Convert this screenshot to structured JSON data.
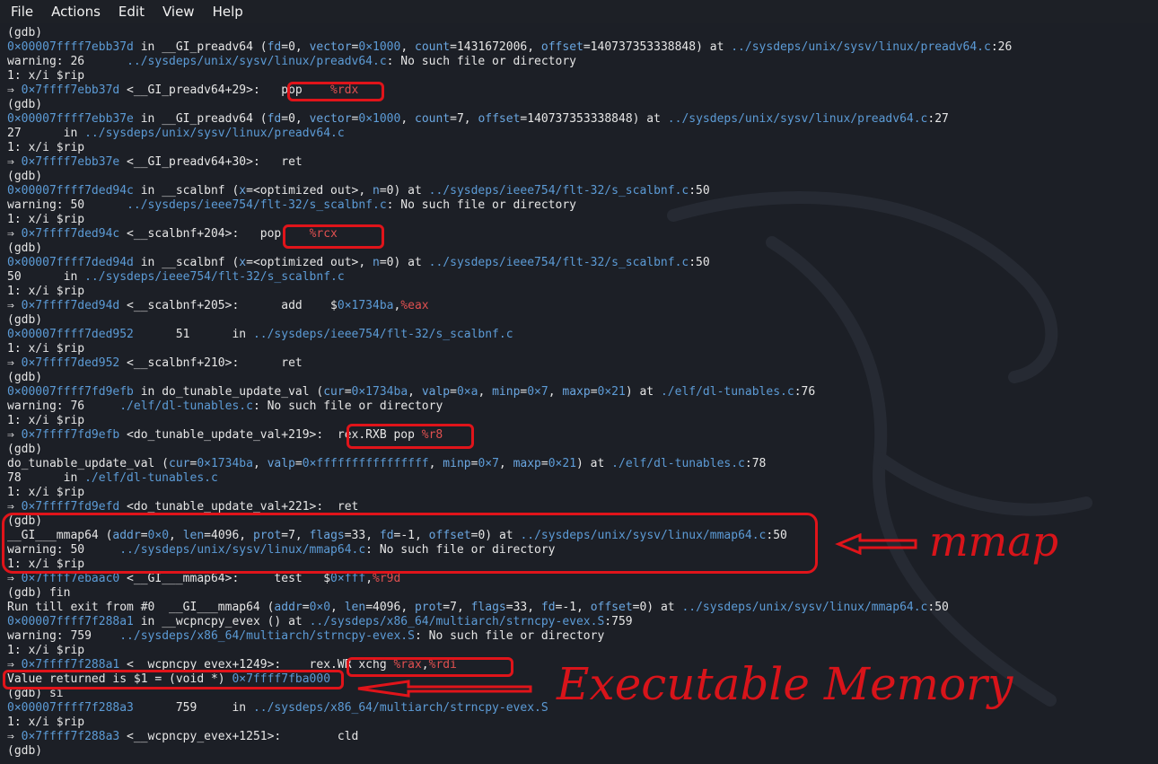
{
  "menubar": {
    "file": "File",
    "actions": "Actions",
    "edit": "Edit",
    "view": "View",
    "help": "Help"
  },
  "terminal": {
    "lines": [
      "(gdb)",
      "0×00007ffff7ebb37d in __GI_preadv64 (fd=0, vector=0×1000, count=1431672006, offset=140737353338848) at ../sysdeps/unix/sysv/linux/preadv64.c:26",
      "warning: 26      ../sysdeps/unix/sysv/linux/preadv64.c: No such file or directory",
      "1: x/i $rip",
      "⇒ 0×7ffff7ebb37d <__GI_preadv64+29>:   pop    %rdx",
      "(gdb)",
      "0×00007ffff7ebb37e in __GI_preadv64 (fd=0, vector=0×1000, count=7, offset=140737353338848) at ../sysdeps/unix/sysv/linux/preadv64.c:27",
      "27      in ../sysdeps/unix/sysv/linux/preadv64.c",
      "1: x/i $rip",
      "⇒ 0×7ffff7ebb37e <__GI_preadv64+30>:   ret",
      "(gdb)",
      "0×00007ffff7ded94c in __scalbnf (x=<optimized out>, n=0) at ../sysdeps/ieee754/flt-32/s_scalbnf.c:50",
      "warning: 50      ../sysdeps/ieee754/flt-32/s_scalbnf.c: No such file or directory",
      "1: x/i $rip",
      "⇒ 0×7ffff7ded94c <__scalbnf+204>:   pop    %rcx",
      "(gdb)",
      "0×00007ffff7ded94d in __scalbnf (x=<optimized out>, n=0) at ../sysdeps/ieee754/flt-32/s_scalbnf.c:50",
      "50      in ../sysdeps/ieee754/flt-32/s_scalbnf.c",
      "1: x/i $rip",
      "⇒ 0×7ffff7ded94d <__scalbnf+205>:      add    $0×1734ba,%eax",
      "(gdb)",
      "0×00007ffff7ded952      51      in ../sysdeps/ieee754/flt-32/s_scalbnf.c",
      "1: x/i $rip",
      "⇒ 0×7ffff7ded952 <__scalbnf+210>:      ret",
      "(gdb)",
      "0×00007ffff7fd9efb in do_tunable_update_val (cur=0×1734ba, valp=0×a, minp=0×7, maxp=0×21) at ./elf/dl-tunables.c:76",
      "warning: 76     ./elf/dl-tunables.c: No such file or directory",
      "1: x/i $rip",
      "⇒ 0×7ffff7fd9efb <do_tunable_update_val+219>:  rex.RXB pop %r8",
      "(gdb)",
      "do_tunable_update_val (cur=0×1734ba, valp=0×ffffffffffffffff, minp=0×7, maxp=0×21) at ./elf/dl-tunables.c:78",
      "78      in ./elf/dl-tunables.c",
      "1: x/i $rip",
      "⇒ 0×7ffff7fd9efd <do_tunable_update_val+221>:  ret",
      "(gdb)",
      "__GI___mmap64 (addr=0×0, len=4096, prot=7, flags=33, fd=-1, offset=0) at ../sysdeps/unix/sysv/linux/mmap64.c:50",
      "warning: 50     ../sysdeps/unix/sysv/linux/mmap64.c: No such file or directory",
      "1: x/i $rip",
      "⇒ 0×7ffff7ebaac0 <__GI___mmap64>:     test   $0×fff,%r9d",
      "(gdb) fin",
      "Run till exit from #0  __GI___mmap64 (addr=0×0, len=4096, prot=7, flags=33, fd=-1, offset=0) at ../sysdeps/unix/sysv/linux/mmap64.c:50",
      "0×00007ffff7f288a1 in __wcpncpy_evex () at ../sysdeps/x86_64/multiarch/strncpy-evex.S:759",
      "warning: 759    ../sysdeps/x86_64/multiarch/strncpy-evex.S: No such file or directory",
      "1: x/i $rip",
      "⇒ 0×7ffff7f288a1 <__wcpncpy_evex+1249>:    rex.WR xchg %rax,%rdi",
      "Value returned is $1 = (void *) 0×7ffff7fba000",
      "(gdb) si",
      "0×00007ffff7f288a3      759     in ../sysdeps/x86_64/multiarch/strncpy-evex.S",
      "1: x/i $rip",
      "⇒ 0×7ffff7f288a3 <__wcpncpy_evex+1251>:        cld",
      "(gdb)"
    ]
  },
  "annotations": {
    "mmap_label": "mmap",
    "exec_label": "Executable Memory"
  },
  "colors": {
    "background": "#1c1f26",
    "address": "#5c9bd6",
    "register": "#e05050",
    "annotation": "#e0141a"
  }
}
